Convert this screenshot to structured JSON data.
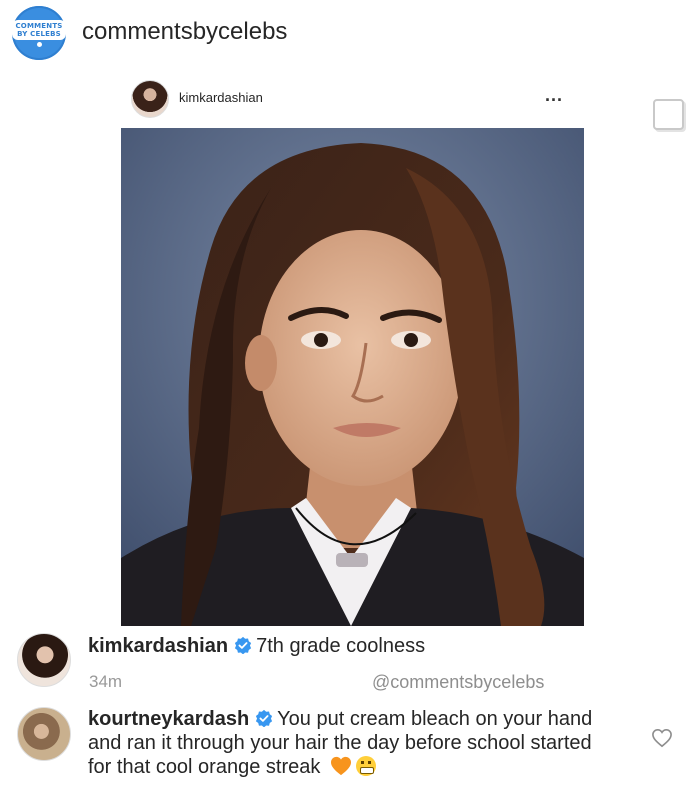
{
  "header": {
    "logo_text_line1": "COMMENTS",
    "logo_text_line2": "BY CELEBS",
    "account_name": "commentsbycelebs"
  },
  "post": {
    "username": "kimkardashian",
    "more_label": "...",
    "image_alt": "kimkardashian post photo"
  },
  "comments": [
    {
      "username": "kimkardashian",
      "verified": true,
      "text": "7th grade coolness"
    },
    {
      "username": "kourtneykardash",
      "verified": true,
      "text": "You put cream bleach on your hand and ran it through your hair the day before school started for that cool orange streak",
      "emojis": [
        "orange-heart",
        "grimacing-face"
      ]
    }
  ],
  "meta": {
    "time": "34m",
    "credit": "@commentsbycelebs"
  },
  "icons": {
    "verified": "verified-badge-icon",
    "heart": "heart-icon",
    "save": "save-icon",
    "more": "more-options-icon"
  },
  "colors": {
    "verified_blue": "#3897f0",
    "logo_blue": "#3a8ee0",
    "muted_text": "#999999",
    "text": "#262626",
    "orange_heart": "#f7941d"
  }
}
